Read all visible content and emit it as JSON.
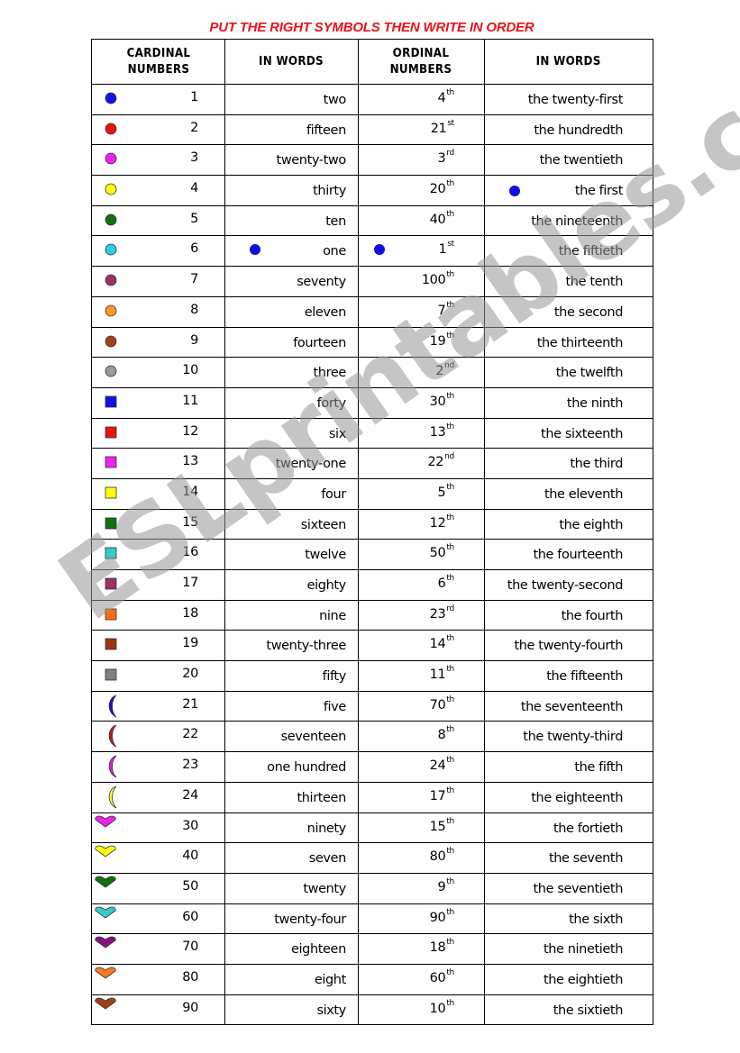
{
  "title": "PUT THE RIGHT SYMBOLS THEN WRITE IN ORDER",
  "headers": {
    "cardinal": [
      "CARDINAL",
      "NUMBERS"
    ],
    "in_words_1": "IN WORDS",
    "ordinal": [
      "ORDINAL",
      "NUMBERS"
    ],
    "in_words_2": "IN WORDS"
  },
  "watermark": "ESLprintables.com",
  "example_marker_color": "#1010e0",
  "rows": [
    {
      "symbol": "circle",
      "color": "#1414e6",
      "cardinal": "1",
      "word": "two",
      "ordinal": "4",
      "suffix": "th",
      "ordinal_word": "the twenty-first"
    },
    {
      "symbol": "circle",
      "color": "#ee1111",
      "cardinal": "2",
      "word": "fifteen",
      "ordinal": "21",
      "suffix": "st",
      "ordinal_word": "the hundredth"
    },
    {
      "symbol": "circle",
      "color": "#ee22ee",
      "cardinal": "3",
      "word": "twenty-two",
      "ordinal": "3",
      "suffix": "rd",
      "ordinal_word": "the twentieth"
    },
    {
      "symbol": "circle",
      "color": "#ffff00",
      "cardinal": "4",
      "word": "thirty",
      "ordinal": "20",
      "suffix": "th",
      "ordinal_word": "the first",
      "example_in": "ordinal_word"
    },
    {
      "symbol": "circle",
      "color": "#127012",
      "cardinal": "5",
      "word": "ten",
      "ordinal": "40",
      "suffix": "th",
      "ordinal_word": "the nineteenth"
    },
    {
      "symbol": "circle",
      "color": "#2ecce8",
      "cardinal": "6",
      "word": "one",
      "ordinal": "1",
      "suffix": "st",
      "ordinal_word": "the fiftieth",
      "example_in": "word_and_ordinal"
    },
    {
      "symbol": "circle",
      "color": "#993366",
      "cardinal": "7",
      "word": "seventy",
      "ordinal": "100",
      "suffix": "th",
      "ordinal_word": "the tenth"
    },
    {
      "symbol": "circle",
      "color": "#ff9922",
      "cardinal": "8",
      "word": "eleven",
      "ordinal": "7",
      "suffix": "th",
      "ordinal_word": "the second"
    },
    {
      "symbol": "circle",
      "color": "#a0401a",
      "cardinal": "9",
      "word": "fourteen",
      "ordinal": "19",
      "suffix": "th",
      "ordinal_word": "the thirteenth"
    },
    {
      "symbol": "circle",
      "color": "#999999",
      "cardinal": "10",
      "word": "three",
      "ordinal": "2",
      "suffix": "nd",
      "ordinal_word": "the twelfth"
    },
    {
      "symbol": "square",
      "color": "#1010e6",
      "cardinal": "11",
      "word": "forty",
      "ordinal": "30",
      "suffix": "th",
      "ordinal_word": "the ninth"
    },
    {
      "symbol": "square",
      "color": "#ee1111",
      "cardinal": "12",
      "word": "six",
      "ordinal": "13",
      "suffix": "th",
      "ordinal_word": "the sixteenth"
    },
    {
      "symbol": "square",
      "color": "#ee22ee",
      "cardinal": "13",
      "word": "twenty-one",
      "ordinal": "22",
      "suffix": "nd",
      "ordinal_word": "the third"
    },
    {
      "symbol": "square",
      "color": "#ffff00",
      "cardinal": "14",
      "word": "four",
      "ordinal": "5",
      "suffix": "th",
      "ordinal_word": "the eleventh"
    },
    {
      "symbol": "square",
      "color": "#117011",
      "cardinal": "15",
      "word": "sixteen",
      "ordinal": "12",
      "suffix": "th",
      "ordinal_word": "the eighth"
    },
    {
      "symbol": "square",
      "color": "#33cccc",
      "cardinal": "16",
      "word": "twelve",
      "ordinal": "50",
      "suffix": "th",
      "ordinal_word": "the fourteenth"
    },
    {
      "symbol": "square",
      "color": "#993366",
      "cardinal": "17",
      "word": "eighty",
      "ordinal": "6",
      "suffix": "th",
      "ordinal_word": "the twenty-second"
    },
    {
      "symbol": "square",
      "color": "#ff6a11",
      "cardinal": "18",
      "word": "nine",
      "ordinal": "23",
      "suffix": "rd",
      "ordinal_word": "the fourth"
    },
    {
      "symbol": "square",
      "color": "#a0360e",
      "cardinal": "19",
      "word": "twenty-three",
      "ordinal": "14",
      "suffix": "th",
      "ordinal_word": "the twenty-fourth"
    },
    {
      "symbol": "square",
      "color": "#808080",
      "cardinal": "20",
      "word": "fifty",
      "ordinal": "11",
      "suffix": "th",
      "ordinal_word": "the fifteenth"
    },
    {
      "symbol": "moon",
      "color": "#1111cc",
      "cardinal": "21",
      "word": "five",
      "ordinal": "70",
      "suffix": "th",
      "ordinal_word": "the seventeenth"
    },
    {
      "symbol": "moon",
      "color": "#b81c1c",
      "cardinal": "22",
      "word": "seventeen",
      "ordinal": "8",
      "suffix": "th",
      "ordinal_word": "the twenty-third"
    },
    {
      "symbol": "moon",
      "color": "#dd22dd",
      "cardinal": "23",
      "word": "one hundred",
      "ordinal": "24",
      "suffix": "th",
      "ordinal_word": "the fifth"
    },
    {
      "symbol": "moon",
      "color": "#ffff33",
      "cardinal": "24",
      "word": "thirteen",
      "ordinal": "17",
      "suffix": "th",
      "ordinal_word": "the eighteenth"
    },
    {
      "symbol": "heart",
      "color": "#ee22ee",
      "cardinal": "30",
      "word": "ninety",
      "ordinal": "15",
      "suffix": "th",
      "ordinal_word": "the fortieth"
    },
    {
      "symbol": "heart",
      "color": "#ffff11",
      "cardinal": "40",
      "word": "seven",
      "ordinal": "80",
      "suffix": "th",
      "ordinal_word": "the seventh"
    },
    {
      "symbol": "heart",
      "color": "#117011",
      "cardinal": "50",
      "word": "twenty",
      "ordinal": "9",
      "suffix": "th",
      "ordinal_word": "the seventieth"
    },
    {
      "symbol": "heart",
      "color": "#33cccc",
      "cardinal": "60",
      "word": "twenty-four",
      "ordinal": "90",
      "suffix": "th",
      "ordinal_word": "the sixth"
    },
    {
      "symbol": "heart",
      "color": "#881188",
      "cardinal": "70",
      "word": "eighteen",
      "ordinal": "18",
      "suffix": "th",
      "ordinal_word": "the ninetieth"
    },
    {
      "symbol": "heart",
      "color": "#ff7722",
      "cardinal": "80",
      "word": "eight",
      "ordinal": "60",
      "suffix": "th",
      "ordinal_word": "the eightieth"
    },
    {
      "symbol": "heart",
      "color": "#a0401a",
      "cardinal": "90",
      "word": "sixty",
      "ordinal": "10",
      "suffix": "th",
      "ordinal_word": "the sixtieth"
    }
  ]
}
